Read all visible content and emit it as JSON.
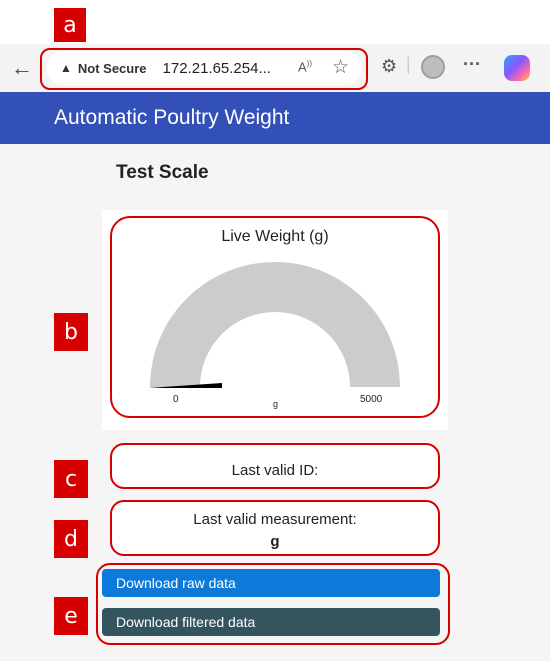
{
  "annotations": {
    "a": "a",
    "b": "b",
    "c": "c",
    "d": "d",
    "e": "e"
  },
  "browser": {
    "back_icon": "back-arrow-icon",
    "not_secure": "Not Secure",
    "url": "172.21.65.254...",
    "read_aloud": "A⁾",
    "colors": {
      "toolbar": "#f3f3f3",
      "annotation_red": "#d70000"
    }
  },
  "app": {
    "title": "Automatic Poultry Weight",
    "header_color": "#3350b8"
  },
  "page": {
    "heading": "Test Scale"
  },
  "gauge": {
    "title": "Live Weight (g)",
    "min_label": "0",
    "max_label": "5000",
    "unit_label": "g",
    "min": 0,
    "max": 5000,
    "value": 0
  },
  "last_id": {
    "label": "Last valid ID:",
    "value": ""
  },
  "last_measurement": {
    "label": "Last valid measurement:",
    "value": "g"
  },
  "buttons": {
    "download_raw": "Download raw data",
    "download_filtered": "Download filtered data",
    "raw_color": "#0d7ad9",
    "filtered_color": "#34545e"
  }
}
